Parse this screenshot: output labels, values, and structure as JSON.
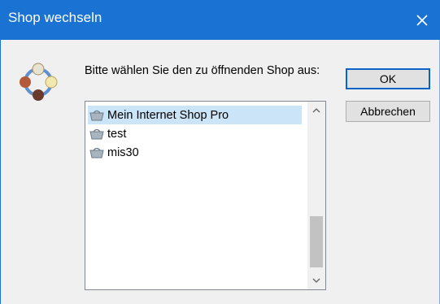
{
  "window": {
    "title": "Shop wechseln",
    "close_label": "✕"
  },
  "dialog": {
    "prompt": "Bitte wählen Sie den zu öffnenden Shop aus:",
    "ok_label": "OK",
    "cancel_label": "Abbrechen"
  },
  "shops": {
    "items": [
      {
        "label": "Mein Internet Shop Pro",
        "selected": true
      },
      {
        "label": "test",
        "selected": false
      },
      {
        "label": "mis30",
        "selected": false
      }
    ]
  },
  "scrollbar": {
    "up": "⌃",
    "down": "⌄"
  },
  "icons": {
    "app": "shop-switch-icon",
    "item": "shop-icon",
    "close": "close-icon"
  },
  "colors": {
    "titlebar": "#1a73d2",
    "selection": "#cce4f7",
    "default_button_border": "#0a64c8"
  }
}
